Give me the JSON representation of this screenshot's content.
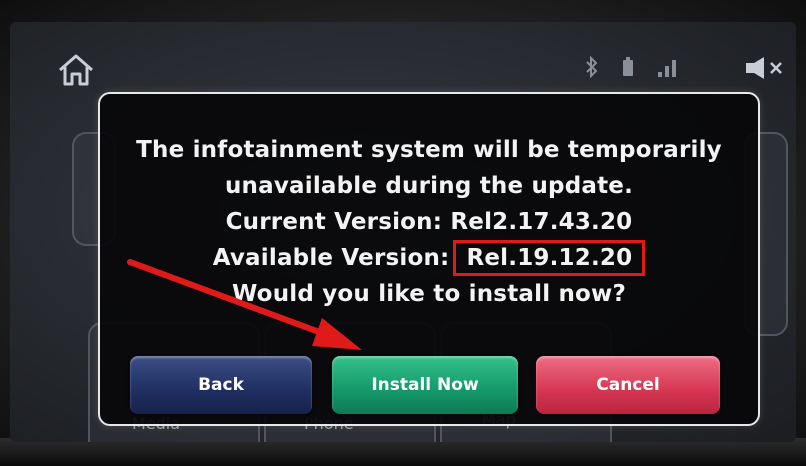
{
  "topbar": {
    "home_icon": "home-icon",
    "status_icons": [
      "bluetooth-icon",
      "battery-icon",
      "signal-icon"
    ],
    "mute_icon": "mute-icon"
  },
  "background_menu": {
    "items": [
      "Media",
      "Phone",
      "Map"
    ]
  },
  "dialog": {
    "line1": "The infotainment system will be temporarily",
    "line2": "unavailable during the update.",
    "current_version_label": "Current Version:",
    "current_version": "Rel2.17.43.20",
    "available_version_label": "Available Version:",
    "available_version": "Rel.19.12.20",
    "question": "Would you like to install now?",
    "buttons": {
      "back": "Back",
      "install": "Install Now",
      "cancel": "Cancel"
    }
  },
  "annotations": {
    "highlight_color": "#e01919",
    "arrow_color": "#e01919"
  }
}
